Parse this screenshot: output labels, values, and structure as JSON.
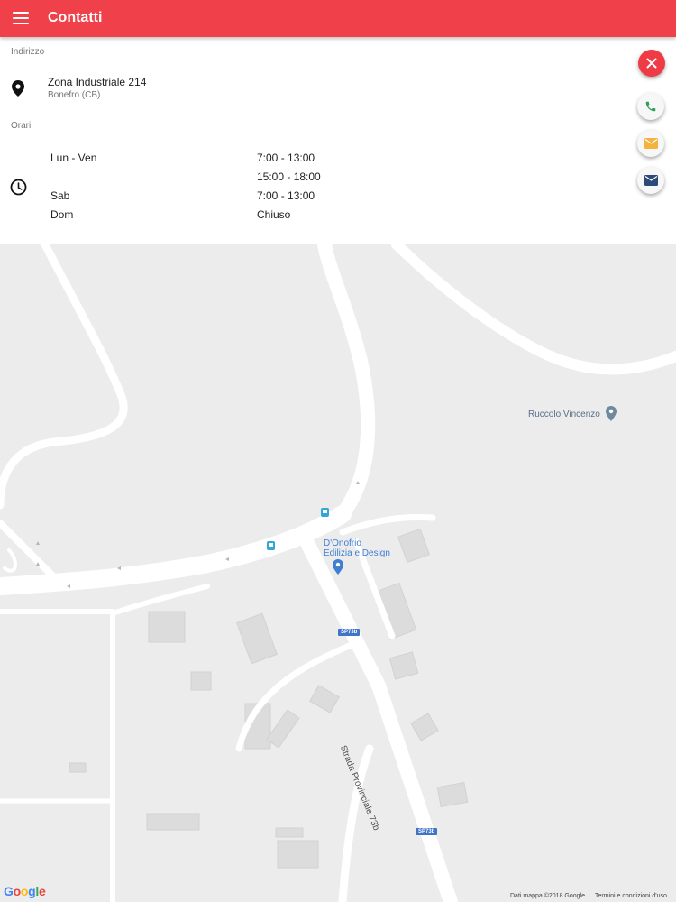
{
  "appbar": {
    "title": "Contatti"
  },
  "address": {
    "section_label": "Indirizzo",
    "line1": "Zona Industriale 214",
    "line2": "Bonefro (CB)"
  },
  "hours": {
    "section_label": "Orari",
    "rows": [
      {
        "day": "Lun - Ven",
        "time": "7:00 - 13:00"
      },
      {
        "day": "",
        "time": "15:00 - 18:00"
      },
      {
        "day": "Sab",
        "time": "7:00 - 13:00"
      },
      {
        "day": "Dom",
        "time": "Chiuso"
      }
    ]
  },
  "fabs": {
    "close": {
      "icon": "close-icon",
      "color": "#ef3b45"
    },
    "phone": {
      "icon": "phone-icon",
      "color": "#2e9e5b"
    },
    "message": {
      "icon": "message-icon",
      "color": "#f3b33d"
    },
    "email": {
      "icon": "mail-icon",
      "color": "#2c4a7a"
    }
  },
  "map": {
    "poi_ruccolo": "Ruccolo Vincenzo",
    "poi_donofrio_1": "D'Onofrio",
    "poi_donofrio_2": "Edilizia e Design",
    "road_badge_1": "SP73b",
    "road_badge_2": "SP73b",
    "road_name": "Strada Provinciale 73b",
    "footer_data": "Dati mappa ©2018 Google",
    "footer_terms": "Termini e condizioni d'uso",
    "google_logo": "Google"
  }
}
